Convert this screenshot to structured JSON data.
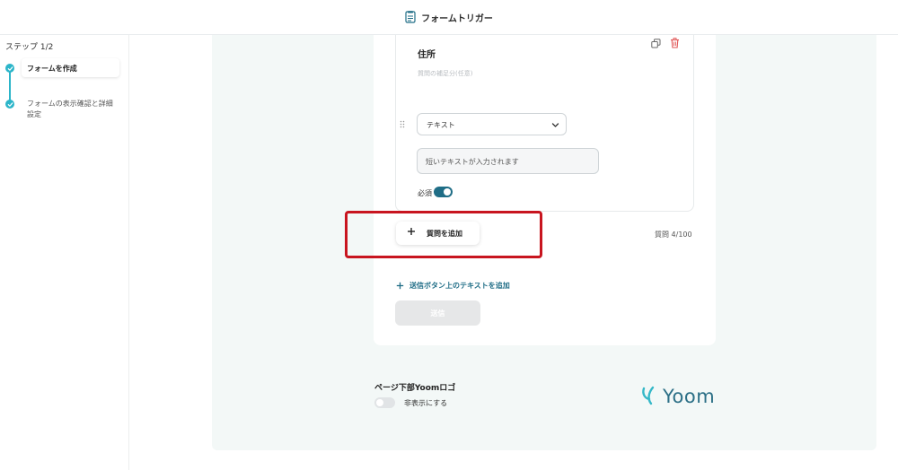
{
  "header": {
    "title": "フォームトリガー"
  },
  "sidebar": {
    "step_count": "ステップ 1/2",
    "steps": [
      {
        "label": "フォームを作成",
        "state": "active"
      },
      {
        "label": "フォームの表示確認と詳細設定",
        "state": "pending"
      }
    ]
  },
  "question": {
    "title": "住所",
    "description_placeholder": "質問の補足分(任意)",
    "type_select": {
      "value": "テキスト"
    },
    "answer_placeholder": "短いテキストが入力されます",
    "required": {
      "label": "必須",
      "enabled": true
    }
  },
  "actions": {
    "add_question_label": "質問を追加",
    "question_count": "質問 4/100",
    "add_submit_text_label": "送信ボタン上のテキストを追加",
    "submit_label": "送信"
  },
  "footer": {
    "logo_setting_title": "ページ下部Yoomロゴ",
    "logo_toggle_label": "非表示にする",
    "logo_toggle_enabled": false,
    "brand": "Yoom"
  },
  "colors": {
    "accent": "#1f6d86",
    "step": "#2cb5c9",
    "highlight": "#c8151f",
    "panel_bg": "#f3f8f7",
    "delete": "#e05555"
  },
  "icons": [
    "form-icon",
    "check-icon",
    "copy-icon",
    "trash-icon",
    "drag-handle-icon",
    "chevron-down-icon",
    "plus-icon",
    "yoom-logo-icon"
  ]
}
